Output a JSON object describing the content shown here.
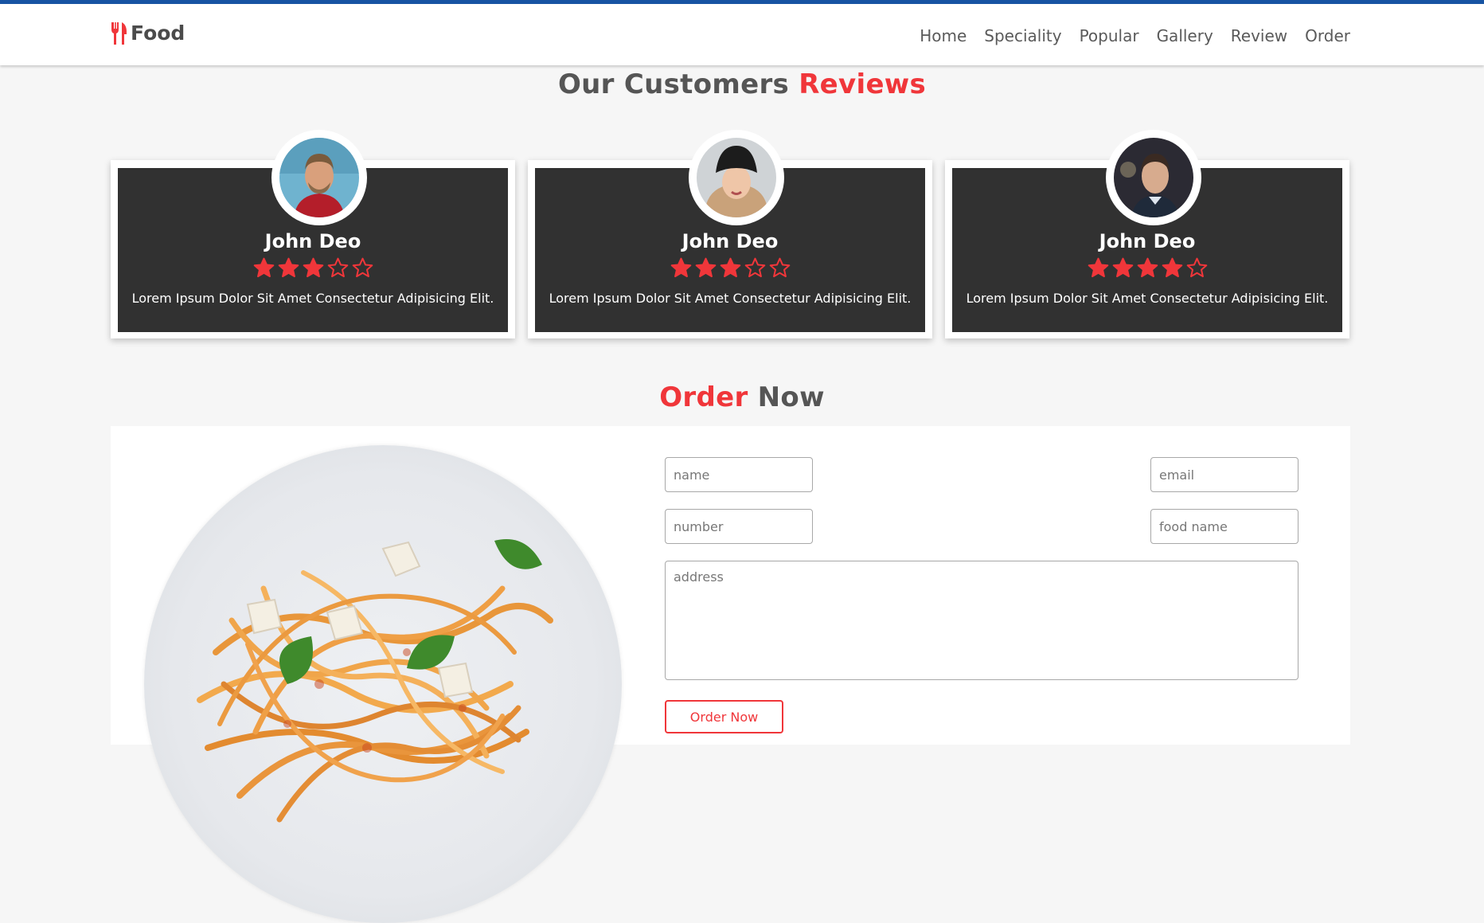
{
  "header": {
    "brand": "Food",
    "nav": [
      "Home",
      "Speciality",
      "Popular",
      "Gallery",
      "Review",
      "Order"
    ]
  },
  "reviews": {
    "title_part1": "Our Customers ",
    "title_part2": "Reviews",
    "cards": [
      {
        "name": "John Deo",
        "rating": 3,
        "max_rating": 5,
        "text": "Lorem Ipsum Dolor Sit Amet Consectetur Adipisicing Elit."
      },
      {
        "name": "John Deo",
        "rating": 3,
        "max_rating": 5,
        "text": "Lorem Ipsum Dolor Sit Amet Consectetur Adipisicing Elit."
      },
      {
        "name": "John Deo",
        "rating": 4,
        "max_rating": 5,
        "text": "Lorem Ipsum Dolor Sit Amet Consectetur Adipisicing Elit."
      }
    ]
  },
  "order": {
    "title_part1": "Order",
    "title_part2": " Now",
    "placeholders": {
      "name": "name",
      "email": "email",
      "number": "number",
      "food_name": "food name",
      "address": "address"
    },
    "button_label": "Order Now"
  },
  "colors": {
    "accent": "#f0363a",
    "card_background": "#313131",
    "top_bar": "#1754a3"
  }
}
